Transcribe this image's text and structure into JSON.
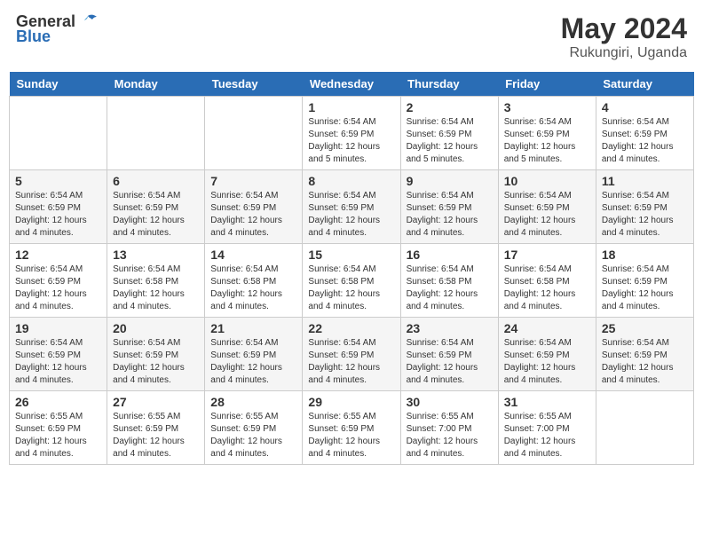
{
  "header": {
    "logo_general": "General",
    "logo_blue": "Blue",
    "month": "May 2024",
    "location": "Rukungiri, Uganda"
  },
  "days_of_week": [
    "Sunday",
    "Monday",
    "Tuesday",
    "Wednesday",
    "Thursday",
    "Friday",
    "Saturday"
  ],
  "weeks": [
    {
      "row_class": "",
      "days": [
        {
          "number": "",
          "content": ""
        },
        {
          "number": "",
          "content": ""
        },
        {
          "number": "",
          "content": ""
        },
        {
          "number": "1",
          "sunrise": "Sunrise: 6:54 AM",
          "sunset": "Sunset: 6:59 PM",
          "daylight": "Daylight: 12 hours and 5 minutes."
        },
        {
          "number": "2",
          "sunrise": "Sunrise: 6:54 AM",
          "sunset": "Sunset: 6:59 PM",
          "daylight": "Daylight: 12 hours and 5 minutes."
        },
        {
          "number": "3",
          "sunrise": "Sunrise: 6:54 AM",
          "sunset": "Sunset: 6:59 PM",
          "daylight": "Daylight: 12 hours and 5 minutes."
        },
        {
          "number": "4",
          "sunrise": "Sunrise: 6:54 AM",
          "sunset": "Sunset: 6:59 PM",
          "daylight": "Daylight: 12 hours and 4 minutes."
        }
      ]
    },
    {
      "row_class": "alt-row",
      "days": [
        {
          "number": "5",
          "sunrise": "Sunrise: 6:54 AM",
          "sunset": "Sunset: 6:59 PM",
          "daylight": "Daylight: 12 hours and 4 minutes."
        },
        {
          "number": "6",
          "sunrise": "Sunrise: 6:54 AM",
          "sunset": "Sunset: 6:59 PM",
          "daylight": "Daylight: 12 hours and 4 minutes."
        },
        {
          "number": "7",
          "sunrise": "Sunrise: 6:54 AM",
          "sunset": "Sunset: 6:59 PM",
          "daylight": "Daylight: 12 hours and 4 minutes."
        },
        {
          "number": "8",
          "sunrise": "Sunrise: 6:54 AM",
          "sunset": "Sunset: 6:59 PM",
          "daylight": "Daylight: 12 hours and 4 minutes."
        },
        {
          "number": "9",
          "sunrise": "Sunrise: 6:54 AM",
          "sunset": "Sunset: 6:59 PM",
          "daylight": "Daylight: 12 hours and 4 minutes."
        },
        {
          "number": "10",
          "sunrise": "Sunrise: 6:54 AM",
          "sunset": "Sunset: 6:59 PM",
          "daylight": "Daylight: 12 hours and 4 minutes."
        },
        {
          "number": "11",
          "sunrise": "Sunrise: 6:54 AM",
          "sunset": "Sunset: 6:59 PM",
          "daylight": "Daylight: 12 hours and 4 minutes."
        }
      ]
    },
    {
      "row_class": "",
      "days": [
        {
          "number": "12",
          "sunrise": "Sunrise: 6:54 AM",
          "sunset": "Sunset: 6:59 PM",
          "daylight": "Daylight: 12 hours and 4 minutes."
        },
        {
          "number": "13",
          "sunrise": "Sunrise: 6:54 AM",
          "sunset": "Sunset: 6:58 PM",
          "daylight": "Daylight: 12 hours and 4 minutes."
        },
        {
          "number": "14",
          "sunrise": "Sunrise: 6:54 AM",
          "sunset": "Sunset: 6:58 PM",
          "daylight": "Daylight: 12 hours and 4 minutes."
        },
        {
          "number": "15",
          "sunrise": "Sunrise: 6:54 AM",
          "sunset": "Sunset: 6:58 PM",
          "daylight": "Daylight: 12 hours and 4 minutes."
        },
        {
          "number": "16",
          "sunrise": "Sunrise: 6:54 AM",
          "sunset": "Sunset: 6:58 PM",
          "daylight": "Daylight: 12 hours and 4 minutes."
        },
        {
          "number": "17",
          "sunrise": "Sunrise: 6:54 AM",
          "sunset": "Sunset: 6:58 PM",
          "daylight": "Daylight: 12 hours and 4 minutes."
        },
        {
          "number": "18",
          "sunrise": "Sunrise: 6:54 AM",
          "sunset": "Sunset: 6:59 PM",
          "daylight": "Daylight: 12 hours and 4 minutes."
        }
      ]
    },
    {
      "row_class": "alt-row",
      "days": [
        {
          "number": "19",
          "sunrise": "Sunrise: 6:54 AM",
          "sunset": "Sunset: 6:59 PM",
          "daylight": "Daylight: 12 hours and 4 minutes."
        },
        {
          "number": "20",
          "sunrise": "Sunrise: 6:54 AM",
          "sunset": "Sunset: 6:59 PM",
          "daylight": "Daylight: 12 hours and 4 minutes."
        },
        {
          "number": "21",
          "sunrise": "Sunrise: 6:54 AM",
          "sunset": "Sunset: 6:59 PM",
          "daylight": "Daylight: 12 hours and 4 minutes."
        },
        {
          "number": "22",
          "sunrise": "Sunrise: 6:54 AM",
          "sunset": "Sunset: 6:59 PM",
          "daylight": "Daylight: 12 hours and 4 minutes."
        },
        {
          "number": "23",
          "sunrise": "Sunrise: 6:54 AM",
          "sunset": "Sunset: 6:59 PM",
          "daylight": "Daylight: 12 hours and 4 minutes."
        },
        {
          "number": "24",
          "sunrise": "Sunrise: 6:54 AM",
          "sunset": "Sunset: 6:59 PM",
          "daylight": "Daylight: 12 hours and 4 minutes."
        },
        {
          "number": "25",
          "sunrise": "Sunrise: 6:54 AM",
          "sunset": "Sunset: 6:59 PM",
          "daylight": "Daylight: 12 hours and 4 minutes."
        }
      ]
    },
    {
      "row_class": "",
      "days": [
        {
          "number": "26",
          "sunrise": "Sunrise: 6:55 AM",
          "sunset": "Sunset: 6:59 PM",
          "daylight": "Daylight: 12 hours and 4 minutes."
        },
        {
          "number": "27",
          "sunrise": "Sunrise: 6:55 AM",
          "sunset": "Sunset: 6:59 PM",
          "daylight": "Daylight: 12 hours and 4 minutes."
        },
        {
          "number": "28",
          "sunrise": "Sunrise: 6:55 AM",
          "sunset": "Sunset: 6:59 PM",
          "daylight": "Daylight: 12 hours and 4 minutes."
        },
        {
          "number": "29",
          "sunrise": "Sunrise: 6:55 AM",
          "sunset": "Sunset: 6:59 PM",
          "daylight": "Daylight: 12 hours and 4 minutes."
        },
        {
          "number": "30",
          "sunrise": "Sunrise: 6:55 AM",
          "sunset": "Sunset: 7:00 PM",
          "daylight": "Daylight: 12 hours and 4 minutes."
        },
        {
          "number": "31",
          "sunrise": "Sunrise: 6:55 AM",
          "sunset": "Sunset: 7:00 PM",
          "daylight": "Daylight: 12 hours and 4 minutes."
        },
        {
          "number": "",
          "content": ""
        }
      ]
    }
  ]
}
